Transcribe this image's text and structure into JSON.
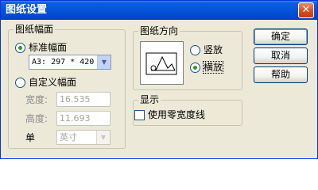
{
  "window": {
    "title": "图纸设置",
    "close_glyph": "✕"
  },
  "paper_size": {
    "legend": "图纸幅面",
    "standard_label": "标准幅面",
    "standard_selected": true,
    "standard_value": "A3: 297 * 420 mm",
    "custom_label": "自定义幅面",
    "custom_selected": false,
    "width_label": "宽度:",
    "width_value": "16.535",
    "height_label": "高度:",
    "height_value": "11.693",
    "unit_label": "单",
    "unit_value": "英寸"
  },
  "orientation": {
    "legend": "图纸方向",
    "portrait_label": "竖放",
    "portrait_selected": false,
    "landscape_label": "横放",
    "landscape_selected": true
  },
  "display": {
    "legend": "显示",
    "zero_width_label": "使用零宽度线",
    "zero_width_checked": false
  },
  "buttons": {
    "ok": "确定",
    "cancel": "取消",
    "help": "帮助"
  },
  "colors": {
    "titlebar": "#0553d9",
    "dialog_bg": "#ece9d8",
    "radio_dot": "#21a121",
    "disabled_text": "#a7a69a"
  }
}
